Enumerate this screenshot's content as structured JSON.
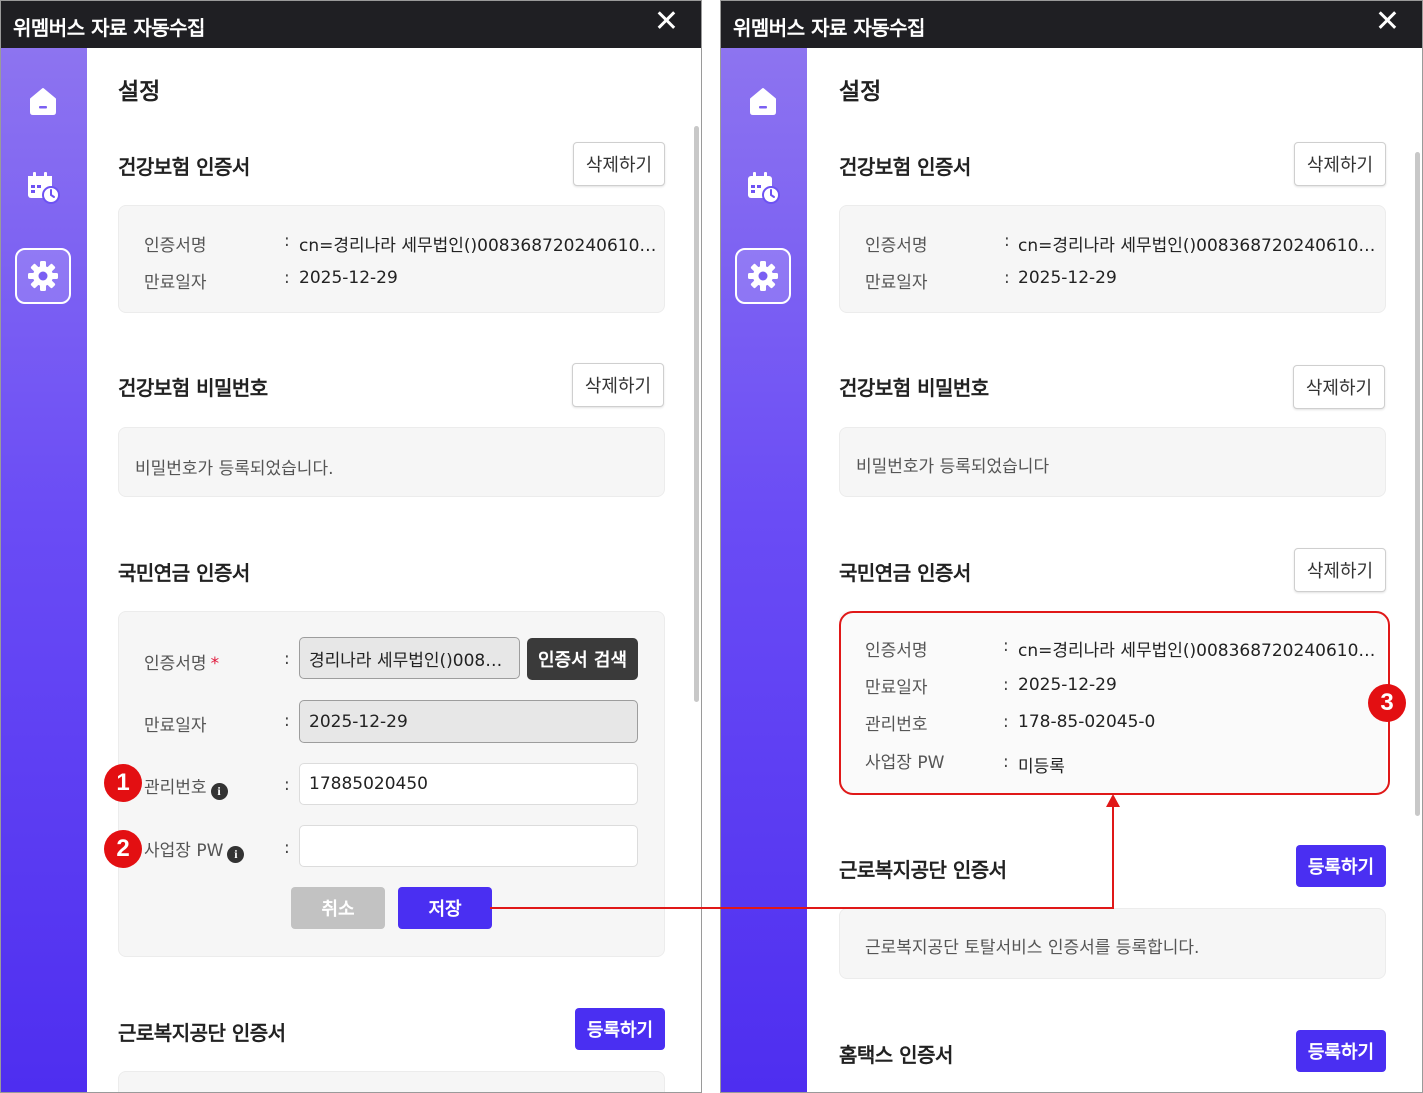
{
  "window_title": "위멤버스 자료 자동수집",
  "close_glyph": "✕",
  "page_title": "설정",
  "common": {
    "delete_label": "삭제하기",
    "register_label": "등록하기",
    "colon": ":",
    "label_cert_name": "인증서명",
    "label_expiry": "만료일자",
    "label_mgmt_no": "관리번호",
    "label_site_pw": "사업장 PW",
    "required_mark": "*",
    "info_glyph": "i"
  },
  "health_cert": {
    "title": "건강보험 인증서",
    "cert_name": "cn=경리나라 세무법인()008368720240610…",
    "expiry": "2025-12-29"
  },
  "health_pw": {
    "title": "건강보험 비밀번호",
    "message_left": "비밀번호가 등록되었습니다.",
    "message_right": "비밀번호가 등록되었습니다"
  },
  "pension_cert": {
    "title": "국민연금 인증서",
    "form": {
      "cert_name_value": "경리나라 세무법인()008…",
      "search_button": "인증서 검색",
      "expiry_value": "2025-12-29",
      "mgmt_no_value": "17885020450",
      "site_pw_value": "",
      "cancel_button": "취소",
      "save_button": "저장"
    },
    "saved": {
      "cert_name": "cn=경리나라 세무법인()008368720240610…",
      "expiry": "2025-12-29",
      "mgmt_no": "178-85-02045-0",
      "site_pw": "미등록"
    }
  },
  "welfare_cert": {
    "title": "근로복지공단 인증서",
    "message": "근로복지공단 토탈서비스 인증서를 등록합니다."
  },
  "hometax_cert": {
    "title": "홈택스 인증서"
  },
  "annotations": {
    "step1": "1",
    "step2": "2",
    "step3": "3",
    "badge_color": "#e30f12"
  },
  "colors": {
    "accent": "#4a2ff2",
    "titlebar": "#1f1f23",
    "sidebar_top": "#8d74f0",
    "sidebar_bottom": "#4e2ef0"
  },
  "sidebar_items": [
    {
      "icon": "home-icon"
    },
    {
      "icon": "calendar-clock-icon"
    },
    {
      "icon": "gear-icon",
      "active": true
    }
  ]
}
